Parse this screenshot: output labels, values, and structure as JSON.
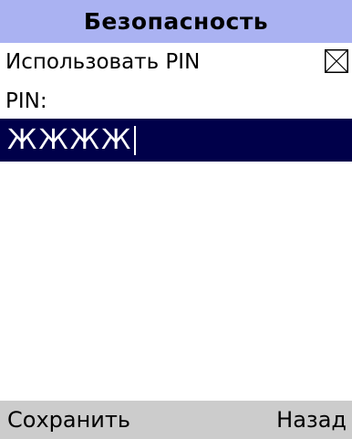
{
  "screen": {
    "title": "Безопасность"
  },
  "use_pin": {
    "label": "Использовать PIN",
    "checked": false
  },
  "pin": {
    "label": "PIN:",
    "value": "ЖЖЖЖ"
  },
  "softkeys": {
    "left": "Сохранить",
    "right": "Назад"
  },
  "colors": {
    "title_bar": "#aab2f2",
    "input_highlight": "#00004a",
    "softkey_bar": "#cccccc"
  },
  "icons": {
    "checkbox": "checkbox-unchecked-icon"
  }
}
